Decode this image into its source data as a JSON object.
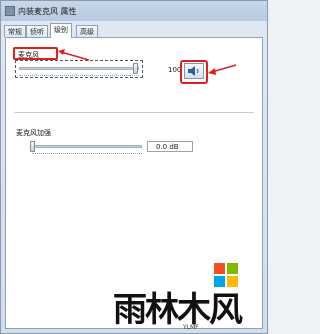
{
  "window": {
    "title": "内装麦克风 属性"
  },
  "tabs": [
    {
      "label": "常规"
    },
    {
      "label": "侦听"
    },
    {
      "label": "级别"
    },
    {
      "label": "高级"
    }
  ],
  "levels": {
    "microphone": {
      "label": "麦克风",
      "value": "100",
      "level_percent": 100
    },
    "boost": {
      "label": "麦克风加强",
      "value": "0.0 dB",
      "level_percent": 0
    }
  },
  "brand": {
    "name": "雨林木风",
    "sub": "YLMF"
  },
  "colors": {
    "annotation": "#e0201c",
    "ms_red": "#f25022",
    "ms_green": "#7fba00",
    "ms_blue": "#00a4ef",
    "ms_yellow": "#ffb900"
  },
  "icons": {
    "speaker": "speaker-icon",
    "window": "window-icon"
  }
}
